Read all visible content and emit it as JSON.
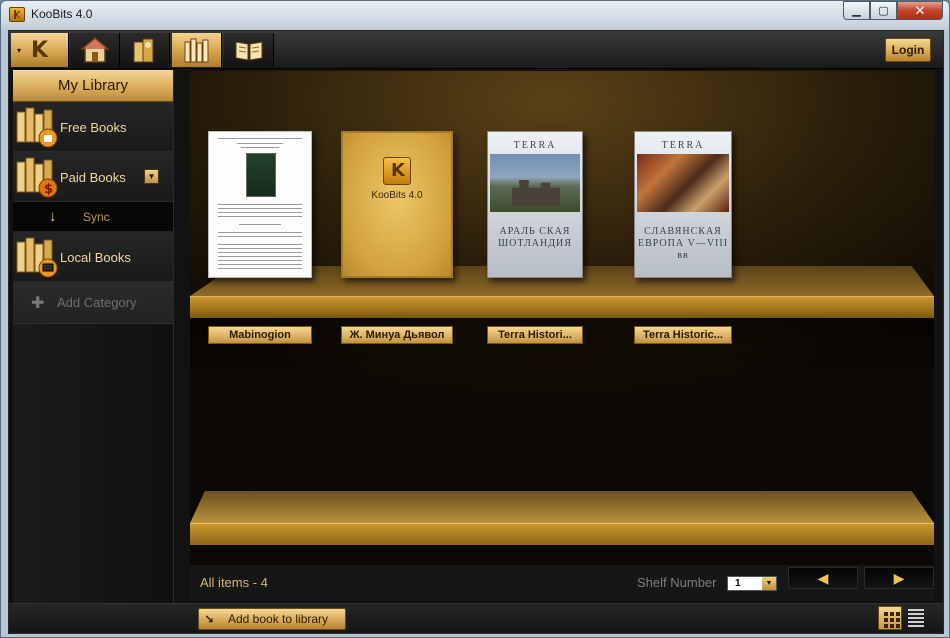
{
  "window": {
    "title": "KooBits 4.0",
    "controls": {
      "minimize": "▁",
      "maximize": "▢",
      "close": "✕"
    }
  },
  "toolbar": {
    "logo": "K",
    "logo_arrow": "▾",
    "icons": [
      "home-icon",
      "reader-icon",
      "library-icon",
      "open-book-icon"
    ],
    "active": "library-icon",
    "login_label": "Login"
  },
  "sidebar": {
    "header": "My Library",
    "items": [
      {
        "label": "Free Books"
      },
      {
        "label": "Paid Books",
        "dropdown": "▼"
      },
      {
        "label": "Sync",
        "sub": true
      },
      {
        "label": "Local Books"
      }
    ],
    "add_category": "Add Category"
  },
  "books": [
    {
      "label": "Mabinogion"
    },
    {
      "label": "Ж. Минуа Дьявол",
      "cover_text": "KooBits 4.0"
    },
    {
      "label": "Terra Histori...",
      "cover_head": "TERRA",
      "cover_title": "АРАЛЬ СКАЯ ШОТЛАНДИЯ"
    },
    {
      "label": "Terra Historic...",
      "cover_head": "TERRA",
      "cover_title": "СЛАВЯНСКАЯ ЕВРОПА V—VIII вв"
    }
  ],
  "status": {
    "all_items": "All items - 4",
    "shelf_number_label": "Shelf Number",
    "shelf_number_value": "1",
    "prev": "◀",
    "next": "▶"
  },
  "bottom": {
    "add_book_label": "Add book to library",
    "add_book_icon": "↘"
  }
}
